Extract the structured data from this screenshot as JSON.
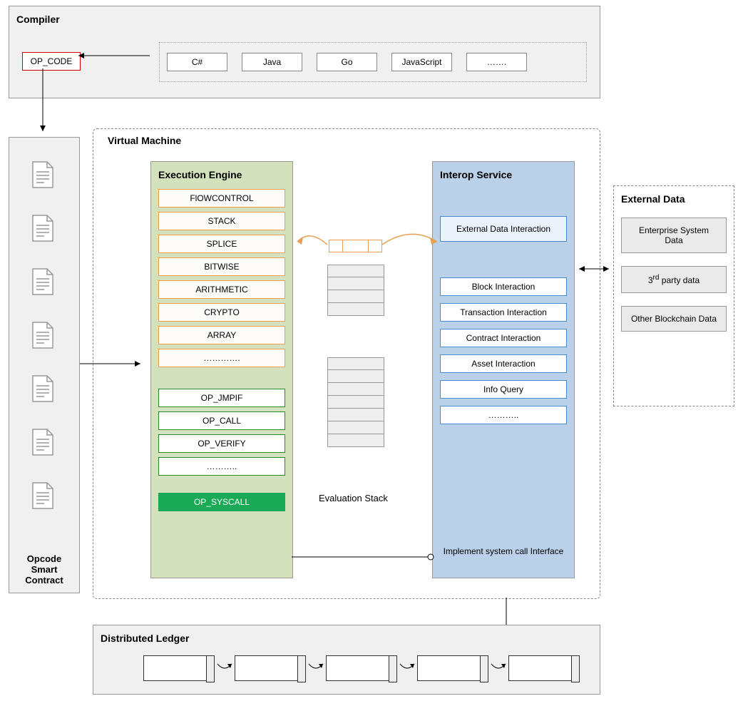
{
  "compiler": {
    "title": "Compiler",
    "opcode": "OP_CODE",
    "langs": [
      "C#",
      "Java",
      "Go",
      "JavaScript",
      "……."
    ]
  },
  "opcode_contract": {
    "title": "Opcode\nSmart\nContract"
  },
  "vm": {
    "title": "Virtual Machine",
    "engine": {
      "title": "Execution Engine",
      "ops": [
        "FlOWCONTROL",
        "STACK",
        "SPLICE",
        "BITWISE",
        "ARITHMETIC",
        "CRYPTO",
        "ARRAY",
        "…………."
      ],
      "calls": [
        "OP_JMPIF",
        "OP_CALL",
        "OP_VERIFY",
        "……….."
      ],
      "syscall": "OP_SYSCALL"
    },
    "eval_stack": "Evaluation Stack",
    "interop": {
      "title": "Interop Service",
      "ext": "External Data Interaction",
      "items": [
        "Block Interaction",
        "Transaction Interaction",
        "Contract Interaction",
        "Asset Interaction",
        "Info Query",
        "……….."
      ],
      "impl": "Implement system call Interface"
    }
  },
  "external": {
    "title": "External Data",
    "items": [
      "Enterprise System Data",
      "3rd party data",
      "Other Blockchain Data"
    ]
  },
  "ledger": {
    "title": "Distributed Ledger"
  }
}
